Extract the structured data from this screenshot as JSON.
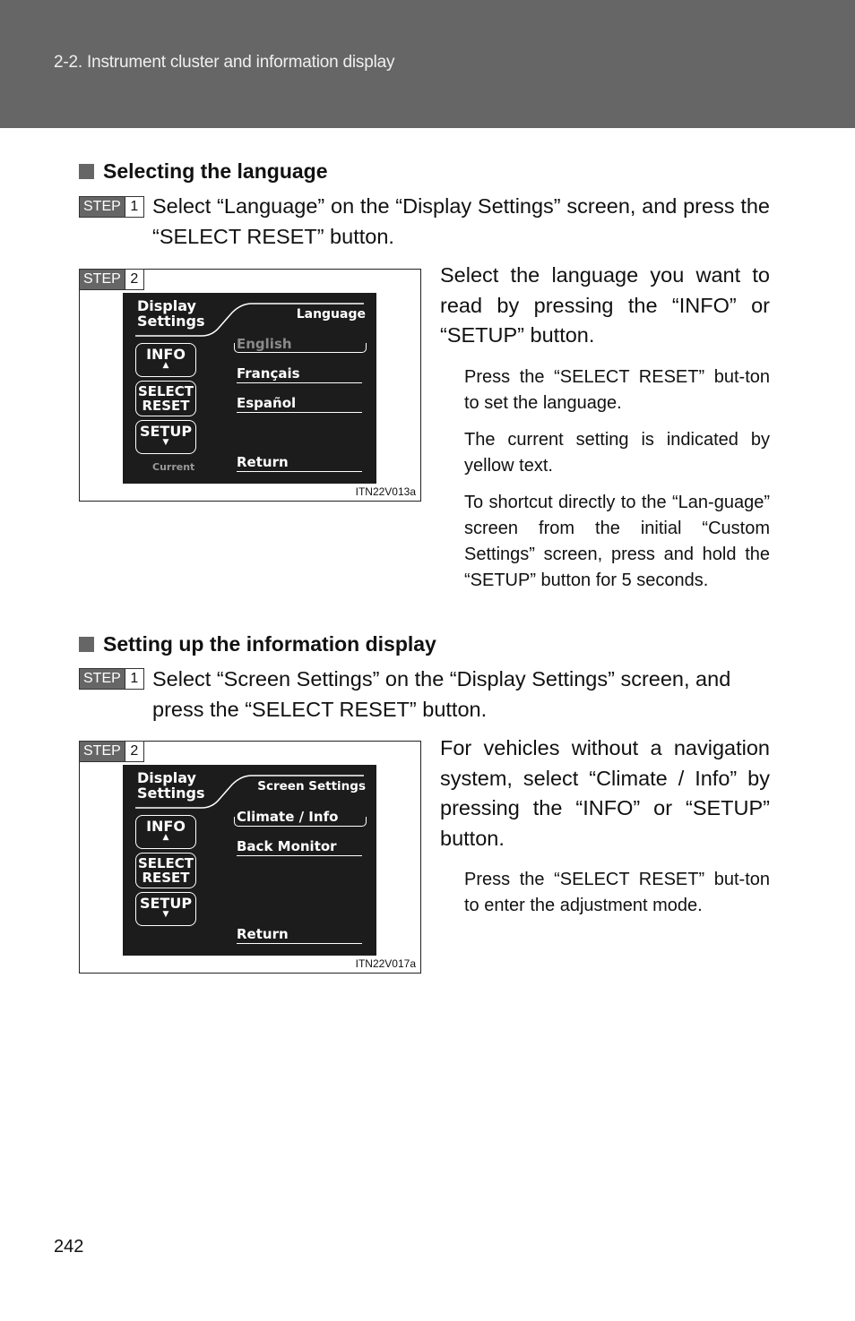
{
  "header": {
    "title": "2-2. Instrument cluster and information display"
  },
  "section1": {
    "heading": "Selecting the language",
    "step1": {
      "label": "STEP",
      "number": "1",
      "text": "Select “Language” on the “Display Settings” screen, and press the “SELECT RESET” button."
    },
    "step2": {
      "label": "STEP",
      "number": "2",
      "text": "Select the language you want to read by pressing the “INFO” or “SETUP” button.",
      "notes": [
        "Press the “SELECT RESET” but-ton to set the language.",
        "The current setting is indicated by yellow text.",
        "To shortcut directly to the “Lan-guage” screen from the initial “Custom Settings” screen, press and hold the “SETUP” button for 5 seconds."
      ],
      "figure": {
        "code": "ITN22V013a",
        "screen": {
          "title_line1": "Display",
          "title_line2": "Settings",
          "header": "Language",
          "buttons": {
            "info": "INFO",
            "select": "SELECT",
            "reset": "RESET",
            "setup": "SETUP"
          },
          "current_label": "Current",
          "options": [
            "English",
            "Français",
            "Español",
            "Return"
          ],
          "selected_option": "English"
        }
      }
    }
  },
  "section2": {
    "heading": "Setting up the information display",
    "step1": {
      "label": "STEP",
      "number": "1",
      "text": "Select “Screen Settings” on the “Display Settings” screen, and press the “SELECT RESET” button."
    },
    "step2": {
      "label": "STEP",
      "number": "2",
      "text": "For vehicles without a navigation system, select “Climate / Info” by pressing the “INFO” or “SETUP” button.",
      "notes": [
        "Press the “SELECT RESET” but-ton to enter the adjustment mode."
      ],
      "figure": {
        "code": "ITN22V017a",
        "screen": {
          "title_line1": "Display",
          "title_line2": "Settings",
          "header": "Screen Settings",
          "buttons": {
            "info": "INFO",
            "select": "SELECT",
            "reset": "RESET",
            "setup": "SETUP"
          },
          "options": [
            "Climate / Info",
            "Back Monitor",
            "Return"
          ],
          "selected_option": "Climate / Info"
        }
      }
    }
  },
  "icons": {
    "up": "▲",
    "down": "▼"
  },
  "page_number": "242"
}
